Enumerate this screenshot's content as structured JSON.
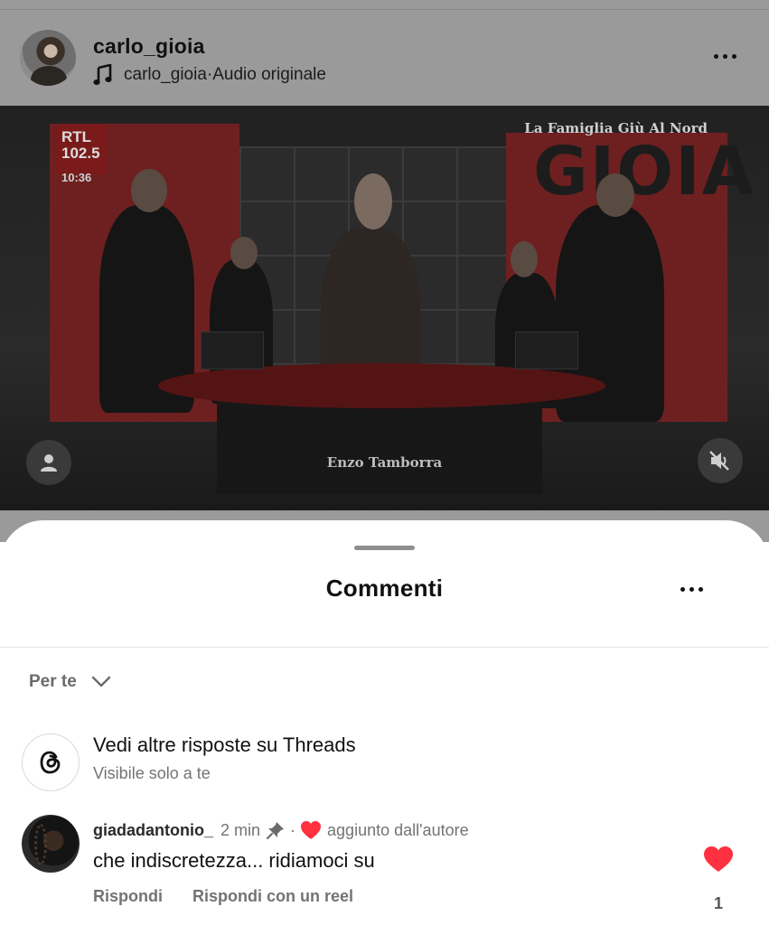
{
  "post": {
    "username": "carlo_gioia",
    "audio_owner": "carlo_gioia",
    "audio_separator": " · ",
    "audio_label": "Audio originale"
  },
  "video": {
    "logo_text": "RTL 102.5",
    "clock": "10:36",
    "overlay_title": "La Famiglia Giù Al Nord",
    "caption": "Enzo Tamborra",
    "icons": [
      "profile-icon",
      "mute-icon"
    ]
  },
  "comments_sheet": {
    "title": "Commenti",
    "sort_label": "Per te",
    "threads": {
      "title": "Vedi altre risposte su Threads",
      "subtitle": "Visibile solo a te"
    },
    "comments": [
      {
        "username": "giadadantonio_",
        "time": "2 min",
        "separator": "·",
        "author_badge": "aggiunto dall'autore",
        "text": "che indiscretezza... ridiamoci su",
        "reply_label": "Rispondi",
        "reply_reel_label": "Rispondi con un reel",
        "likes": "1",
        "liked": true
      }
    ]
  },
  "colors": {
    "like_red": "#ff3040",
    "dim_overlay": "#9a9a9a",
    "muted_text": "#737373"
  }
}
